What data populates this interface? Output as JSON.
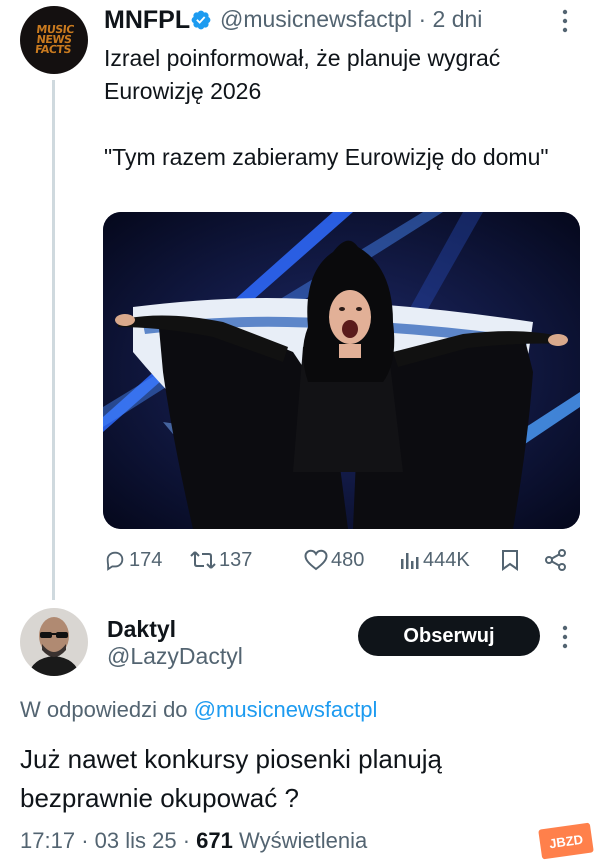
{
  "tweet": {
    "author_name": "MNFPL",
    "author_handle": "@musicnewsfactpl",
    "time_sep": "·",
    "time": "2 dni",
    "avatar_text": "MUSIC NEWS FACTS",
    "text_line1": "Izrael poinformował, że planuje wygrać Eurowizję 2026",
    "text_quote": "\"Tym razem zabieramy Eurowizję do domu\"",
    "actions": {
      "replies": "174",
      "reposts": "137",
      "likes": "480",
      "views": "444K"
    }
  },
  "reply": {
    "author_name": "Daktyl",
    "author_handle": "@LazyDactyl",
    "follow_label": "Obserwuj",
    "replying_prefix": "W odpowiedzi do",
    "replying_to": "@musicnewsfactpl",
    "text": "Już nawet konkursy piosenki planują bezprawnie okupować ?",
    "time": "17:17",
    "date": "03 lis 25",
    "views_count": "671",
    "views_label": "Wyświetlenia",
    "sep": "·"
  },
  "watermark": "JBZD",
  "colors": {
    "accent": "#1d9bf0",
    "secondary_text": "#536471",
    "primary_text": "#0f1419",
    "logo": "#c97a1f"
  }
}
